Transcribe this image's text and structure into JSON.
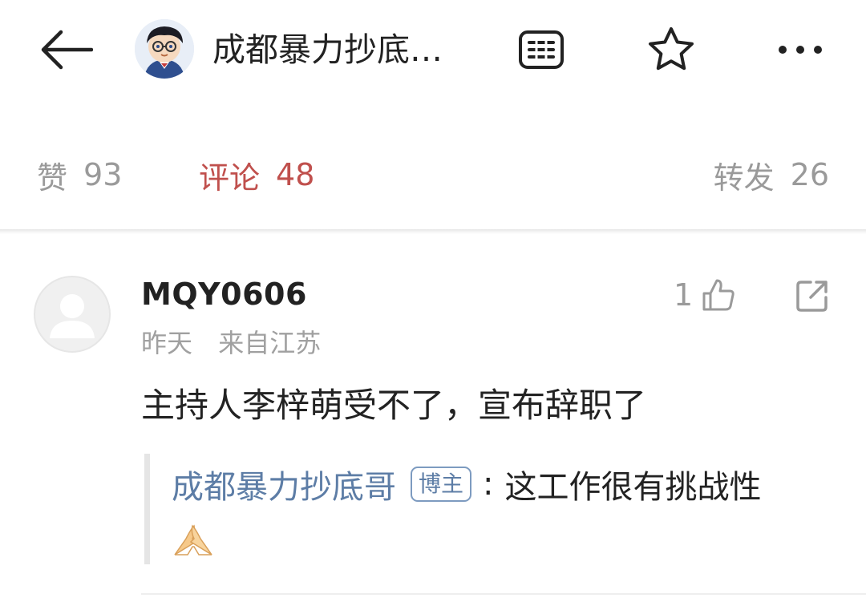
{
  "header": {
    "title": "成都暴力抄底…",
    "icons": {
      "back": "back-arrow-icon",
      "avatar": "avatar",
      "reader": "reader-mode-icon",
      "star": "star-icon",
      "more": "more-dots-icon"
    }
  },
  "tabs": {
    "like": {
      "label": "赞",
      "count": "93"
    },
    "comment": {
      "label": "评论",
      "count": "48"
    },
    "repost": {
      "label": "转发",
      "count": "26"
    }
  },
  "colors": {
    "accent": "#c0504d",
    "link": "#5d7da6",
    "muted": "#9a9a9a"
  },
  "comment": {
    "username": "MQY0606",
    "time": "昨天",
    "location": "来自江苏",
    "text": "主持人李梓萌受不了，宣布辞职了",
    "likes": "1",
    "reply": {
      "author": "成都暴力抄底哥",
      "badge": "博主",
      "separator": ":",
      "text": "这工作很有挑战性",
      "emoji": "pray-hands-emoji"
    }
  }
}
